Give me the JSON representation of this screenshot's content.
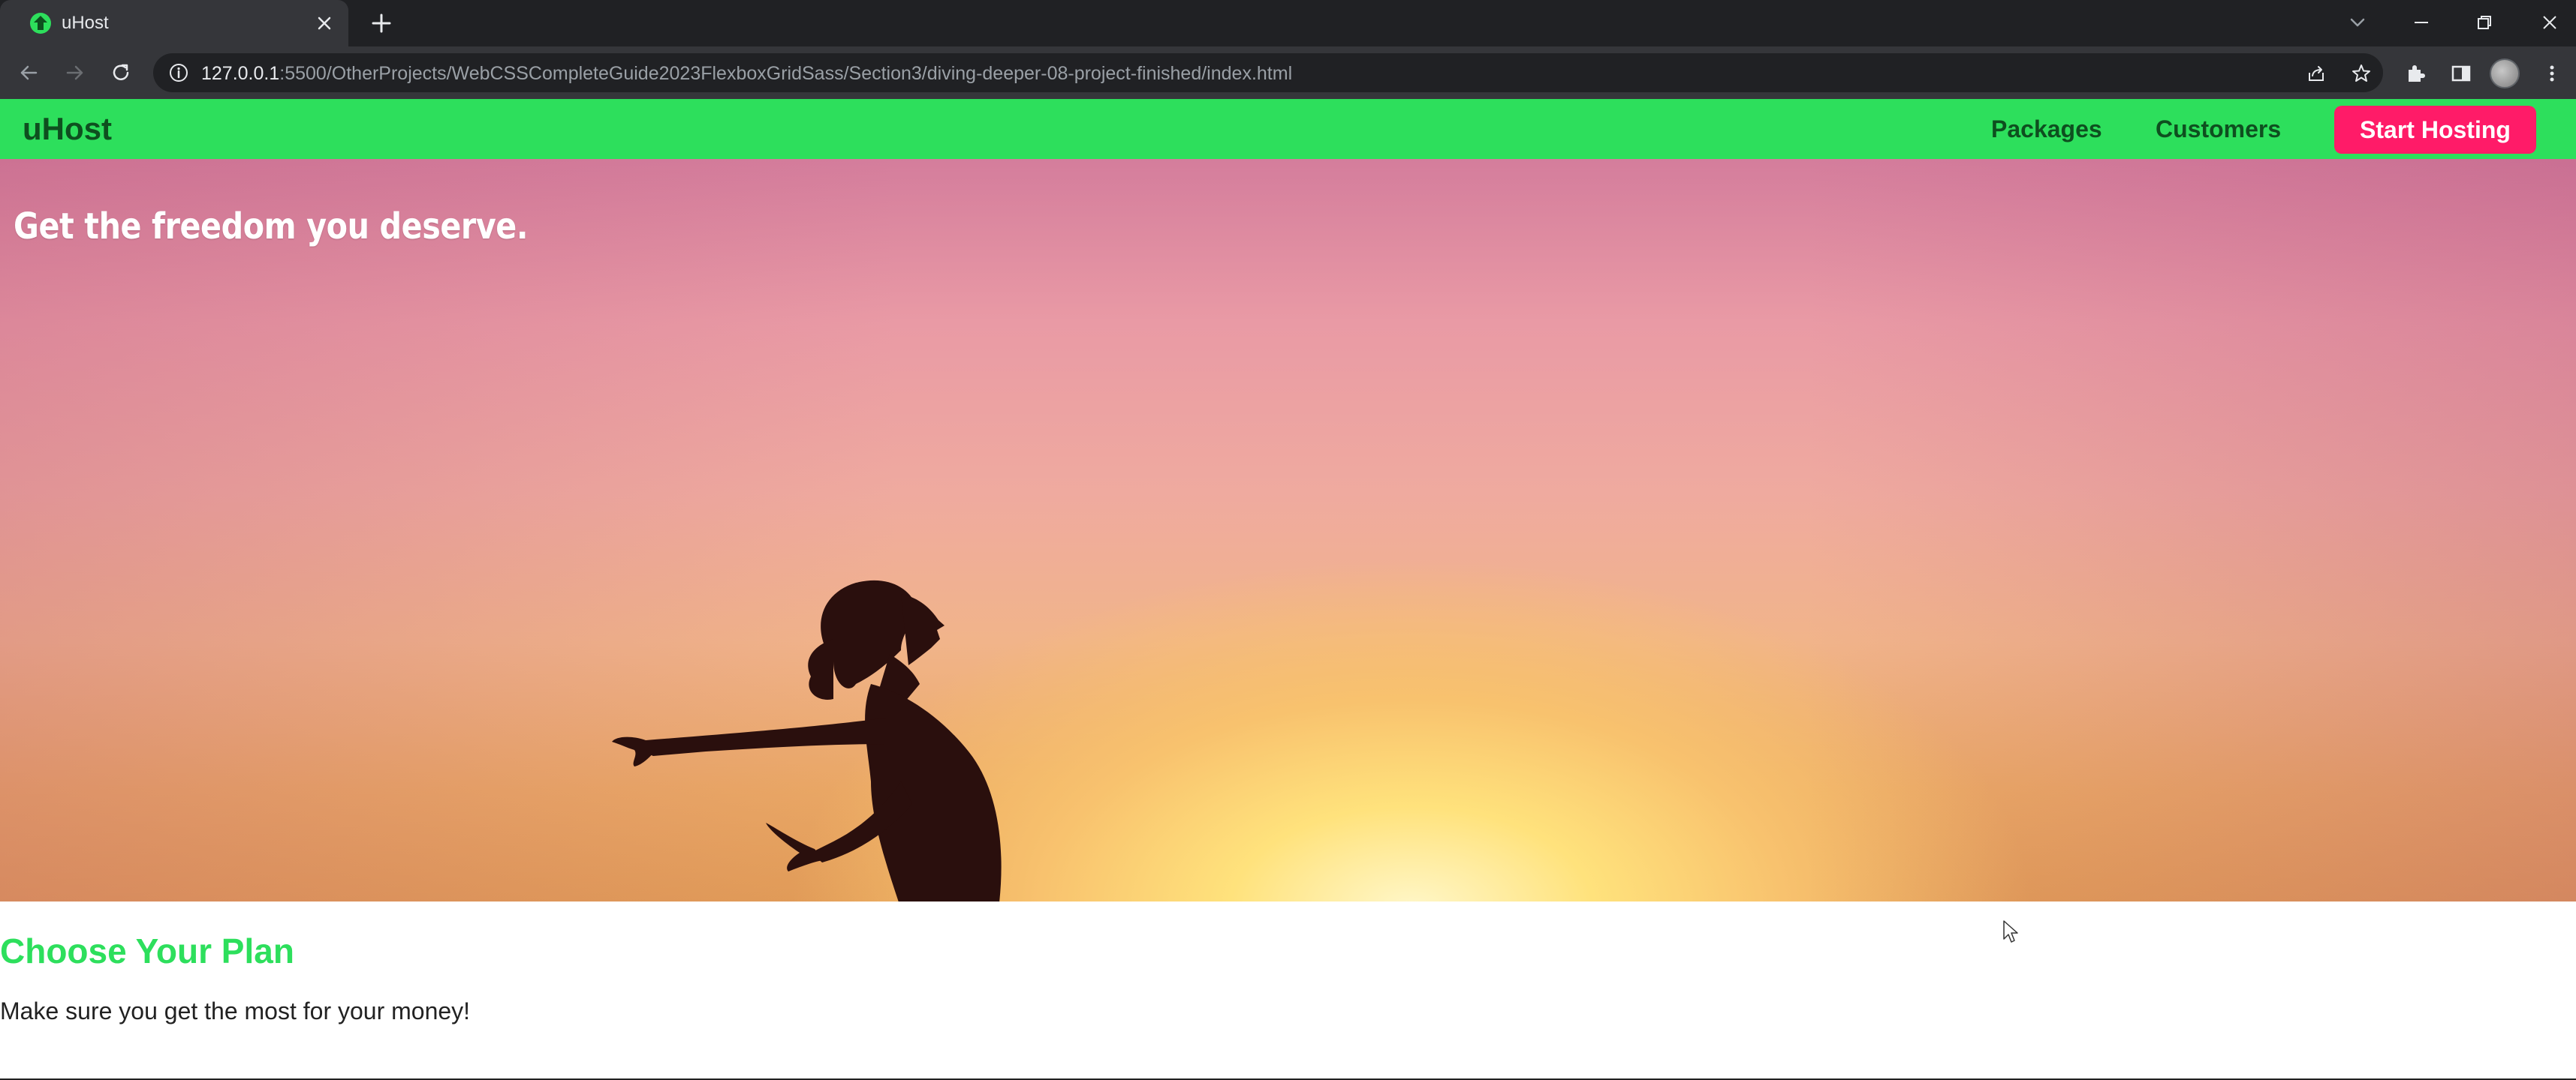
{
  "browser": {
    "tab": {
      "title": "uHost",
      "favicon": "uhost-favicon-icon"
    },
    "url": {
      "host": "127.0.0.1",
      "rest": ":5500/OtherProjects/WebCSSCompleteGuide2023FlexboxGridSass/Section3/diving-deeper-08-project-finished/index.html"
    },
    "colors": {
      "tabstrip": "#202124",
      "toolbar": "#35363a",
      "omnibox": "#202124"
    }
  },
  "site": {
    "brand": "uHost",
    "nav": {
      "items": [
        {
          "label": "Packages"
        },
        {
          "label": "Customers"
        }
      ],
      "cta": "Start Hosting"
    },
    "hero": {
      "title": "Get the freedom you deserve."
    },
    "plans": {
      "title": "Choose Your Plan",
      "subtitle": "Make sure you get the most for your money!"
    },
    "colors": {
      "header": "#2ddf5c",
      "brand_text": "#0e4f1f",
      "cta": "#ff1b68",
      "plans_title": "#2ddf5c"
    }
  }
}
